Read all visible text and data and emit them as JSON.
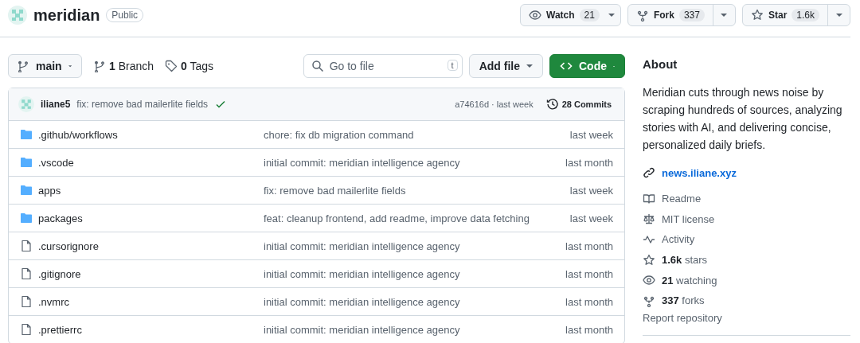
{
  "repo": {
    "name": "meridian",
    "visibility": "Public"
  },
  "actions": [
    {
      "kind": "watch",
      "label": "Watch",
      "count": "21"
    },
    {
      "kind": "fork",
      "label": "Fork",
      "count": "337"
    },
    {
      "kind": "star",
      "label": "Star",
      "count": "1.6k"
    }
  ],
  "toolbar": {
    "branch": "main",
    "branches": "**1** Branch",
    "tags": "**0** Tags",
    "search": {
      "placeholder": "Go to file",
      "shortcut": "t"
    },
    "add_file": "Add file",
    "code": "Code"
  },
  "last_commit": {
    "author": "iliane5",
    "message": "fix: remove bad mailerlite fields",
    "status_ok": true,
    "hash_time": "a74616d · last week",
    "commits": "28 Commits"
  },
  "files": [
    {
      "kind": "folder",
      "name": ".github/workflows",
      "message": "chore: fix db migration command",
      "time": "last week"
    },
    {
      "kind": "folder",
      "name": ".vscode",
      "message": "initial commit: meridian intelligence agency",
      "time": "last month"
    },
    {
      "kind": "folder",
      "name": "apps",
      "message": "fix: remove bad mailerlite fields",
      "time": "last week"
    },
    {
      "kind": "folder",
      "name": "packages",
      "message": "feat: cleanup frontend, add readme, improve data fetching",
      "time": "last week"
    },
    {
      "kind": "file",
      "name": ".cursorignore",
      "message": "initial commit: meridian intelligence agency",
      "time": "last month"
    },
    {
      "kind": "file",
      "name": ".gitignore",
      "message": "initial commit: meridian intelligence agency",
      "time": "last month"
    },
    {
      "kind": "file",
      "name": ".nvmrc",
      "message": "initial commit: meridian intelligence agency",
      "time": "last month"
    },
    {
      "kind": "file",
      "name": ".prettierrc",
      "message": "initial commit: meridian intelligence agency",
      "time": "last month"
    }
  ],
  "about": {
    "title": "About",
    "description": "Meridian cuts through news noise by scraping hundreds of sources, analyzing stories with AI, and delivering concise, personalized daily briefs.",
    "website": "news.iliane.xyz",
    "items": [
      {
        "kind": "book",
        "text": "Readme"
      },
      {
        "kind": "law",
        "text": "MIT license"
      },
      {
        "kind": "pulse",
        "text": "Activity"
      },
      {
        "kind": "star",
        "text": "**1.6k** stars"
      },
      {
        "kind": "eye",
        "text": "**21** watching"
      },
      {
        "kind": "fork",
        "text": "**337** forks"
      }
    ],
    "report": "Report repository"
  }
}
